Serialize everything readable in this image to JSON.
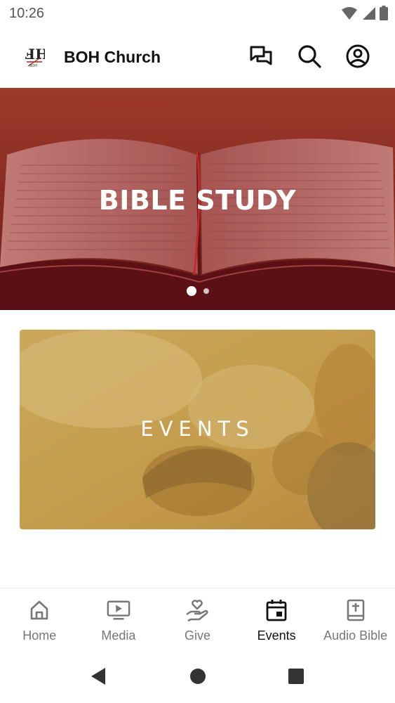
{
  "status_bar": {
    "time": "10:26",
    "icons": [
      "wifi-icon",
      "cell-signal-icon",
      "battery-icon"
    ]
  },
  "app_bar": {
    "logo_icon": "boh-logo",
    "title": "BOH Church",
    "actions": [
      "chat-icon",
      "search-icon",
      "account-icon"
    ]
  },
  "carousel": {
    "slide_title": "BIBLE STUDY",
    "slide_count": 2,
    "active_slide": 0
  },
  "events_card": {
    "label": "EVENTS"
  },
  "bottom_nav": {
    "items": [
      {
        "label": "Home",
        "icon": "home-icon",
        "active": false
      },
      {
        "label": "Media",
        "icon": "media-play-icon",
        "active": false
      },
      {
        "label": "Give",
        "icon": "give-hand-heart-icon",
        "active": false
      },
      {
        "label": "Events",
        "icon": "calendar-icon",
        "active": true
      },
      {
        "label": "Audio Bible",
        "icon": "bible-book-icon",
        "active": false
      }
    ]
  },
  "system_nav": {
    "buttons": [
      "back-icon",
      "home-circle-icon",
      "recents-square-icon"
    ]
  },
  "colors": {
    "carousel_overlay": "#8e1f1f",
    "events_overlay": "#c9a24f",
    "active_nav": "#111111",
    "inactive_nav": "#777777"
  }
}
